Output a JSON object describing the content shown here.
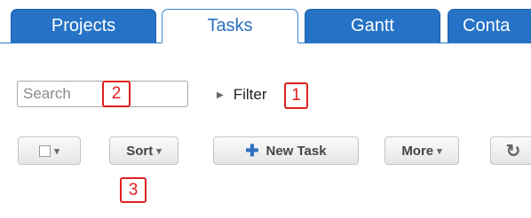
{
  "tabs": [
    {
      "label": "Projects"
    },
    {
      "label": "Tasks"
    },
    {
      "label": "Gantt"
    },
    {
      "label": "Conta"
    }
  ],
  "search": {
    "placeholder": "Search"
  },
  "filter": {
    "label": "Filter"
  },
  "toolbar": {
    "select_caret": "▾",
    "sort_label": "Sort",
    "sort_caret": "▾",
    "new_task_label": "New Task",
    "more_label": "More",
    "more_caret": "▾",
    "refresh_icon": "refresh-icon"
  },
  "callouts": [
    "1",
    "2",
    "3"
  ],
  "colors": {
    "tab_blue": "#2572c6",
    "callout_red": "#e02020"
  }
}
